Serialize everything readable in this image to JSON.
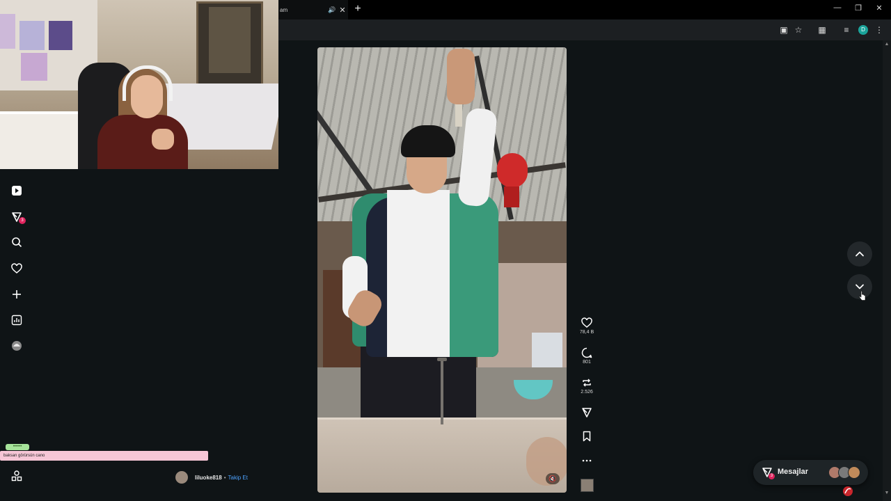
{
  "browser": {
    "tab_title": "am",
    "new_tab_label": "+",
    "profile_initial": "D"
  },
  "sidebar": {
    "notification_count": "3"
  },
  "chat": {
    "username": "••••••",
    "message": "baksan görürsün cano"
  },
  "post": {
    "username": "liluoke818",
    "separator": "•",
    "follow_label": "Takip Et",
    "likes": "78,4 B",
    "comments": "801",
    "reposts": "2.526"
  },
  "messages": {
    "label": "Mesajlar",
    "count": "3"
  },
  "colors": {
    "accent": "#4da3ff",
    "badge": "#e0245e",
    "background": "#0f1416"
  }
}
